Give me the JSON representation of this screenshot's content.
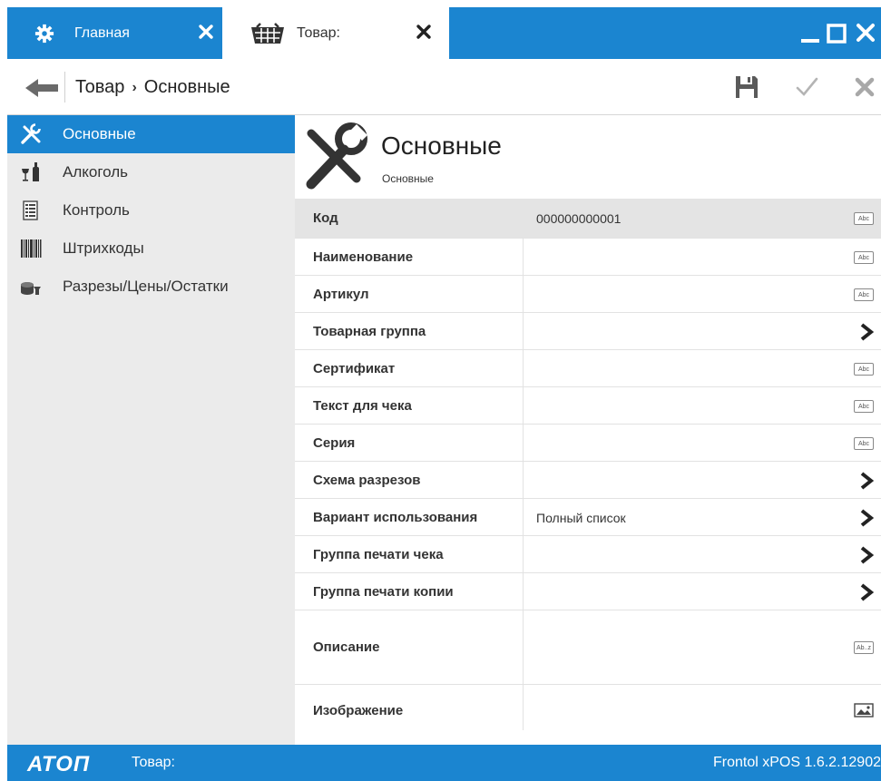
{
  "tabs": [
    {
      "label": "Главная",
      "icon": "gear-icon"
    },
    {
      "label": "Товар:",
      "icon": "basket-icon"
    }
  ],
  "toolbar": {
    "breadcrumb_root": "Товар",
    "breadcrumb_sep": "›",
    "breadcrumb_current": "Основные"
  },
  "sidebar": {
    "items": [
      {
        "label": "Основные",
        "icon": "tools-icon",
        "active": true
      },
      {
        "label": "Алкоголь",
        "icon": "wine-icon"
      },
      {
        "label": "Контроль",
        "icon": "checklist-icon"
      },
      {
        "label": "Штрихкоды",
        "icon": "barcode-icon"
      },
      {
        "label": "Разрезы/Цены/Остатки",
        "icon": "coins-icon"
      }
    ]
  },
  "section": {
    "title": "Основные",
    "subtitle": "Основные"
  },
  "fields": [
    {
      "label": "Код",
      "value": "000000000001",
      "control": "abc"
    },
    {
      "label": "Наименование",
      "value": "",
      "control": "abc"
    },
    {
      "label": "Артикул",
      "value": "",
      "control": "abc"
    },
    {
      "label": "Товарная группа",
      "value": "",
      "control": "chevron"
    },
    {
      "label": "Сертификат",
      "value": "",
      "control": "abc"
    },
    {
      "label": "Текст для чека",
      "value": "",
      "control": "abc"
    },
    {
      "label": "Серия",
      "value": "",
      "control": "abc"
    },
    {
      "label": "Схема разрезов",
      "value": "",
      "control": "chevron"
    },
    {
      "label": "Вариант использования",
      "value": "Полный список",
      "control": "chevron"
    },
    {
      "label": "Группа печати чека",
      "value": "",
      "control": "chevron"
    },
    {
      "label": "Группа печати копии",
      "value": "",
      "control": "chevron"
    },
    {
      "label": "Описание",
      "value": "",
      "control": "abz"
    },
    {
      "label": "Изображение",
      "value": "",
      "control": "image"
    }
  ],
  "controls": {
    "abc": "Abc",
    "abz": "Ab..z"
  },
  "status": {
    "logo": "АТОП",
    "text": "Товар:",
    "version": "Frontol xPOS 1.6.2.12902"
  },
  "colors": {
    "accent": "#1b85d0",
    "sidebar_bg": "#ebebeb",
    "selected_row": "#e4e4e4"
  }
}
